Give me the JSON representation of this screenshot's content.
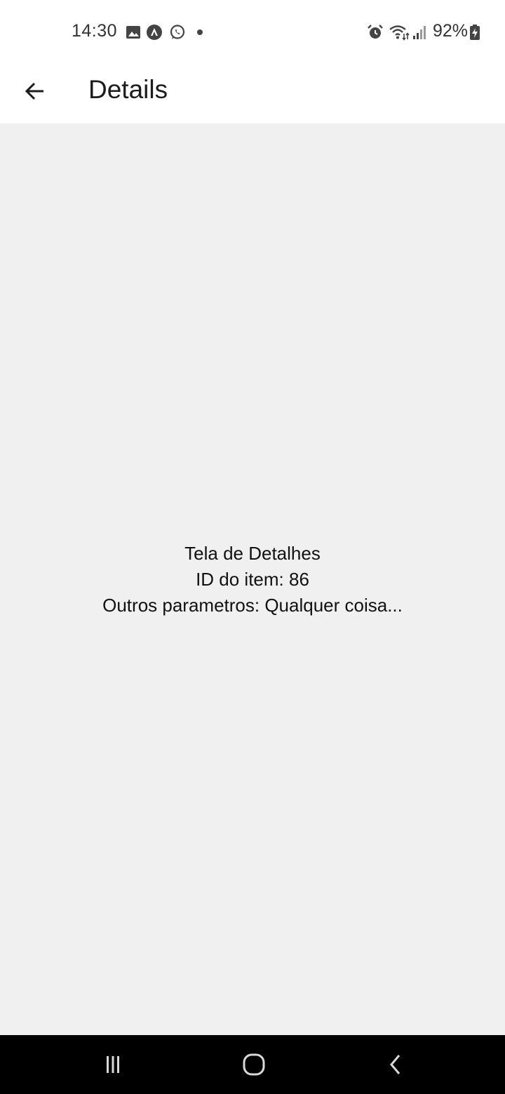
{
  "status_bar": {
    "time": "14:30",
    "battery": "92%",
    "left_icons": [
      "gallery-icon",
      "navigation-icon",
      "whatsapp-icon",
      "notification-dot"
    ],
    "right_icons": [
      "alarm-icon",
      "wifi-icon",
      "signal-icon",
      "battery-charging-icon"
    ]
  },
  "app_bar": {
    "title": "Details",
    "back_icon": "back-arrow-icon"
  },
  "content": {
    "heading": "Tela de Detalhes",
    "item_id": "ID do item: 86",
    "other_params": "Outros parametros: Qualquer coisa..."
  },
  "nav_bar": {
    "buttons": [
      "recent-apps-icon",
      "home-icon",
      "back-icon"
    ]
  },
  "colors": {
    "background": "#f0f0f0",
    "app_bar": "#ffffff",
    "nav_bar": "#000000"
  }
}
